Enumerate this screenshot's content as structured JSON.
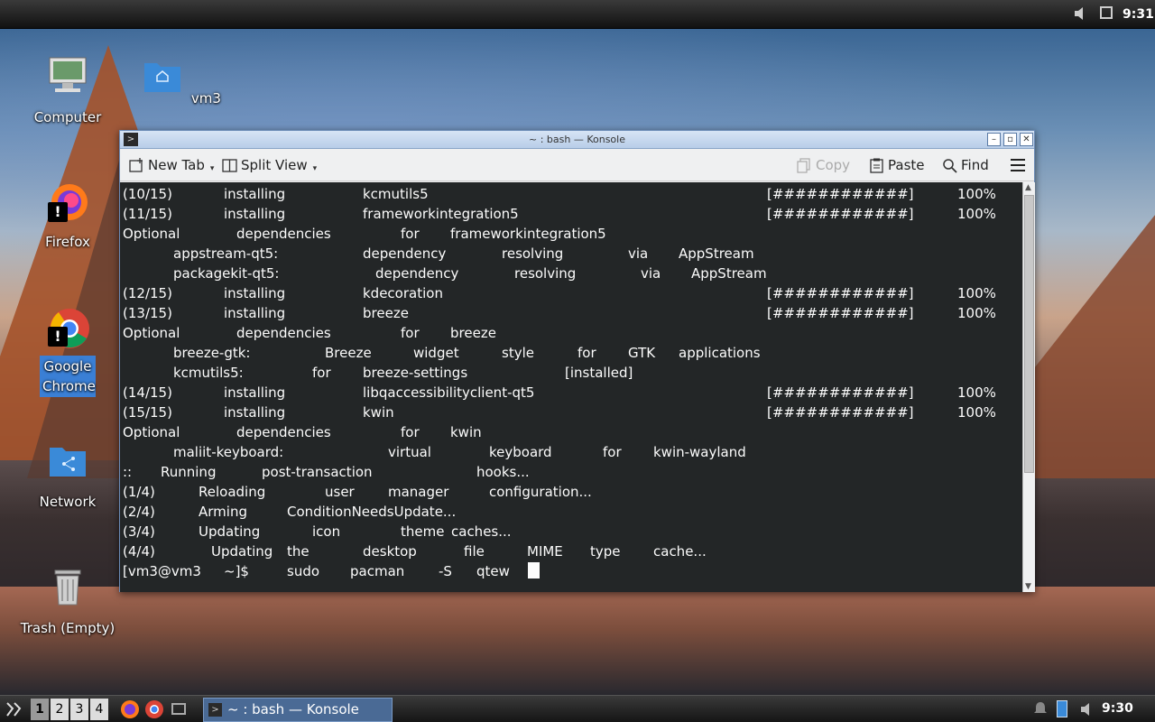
{
  "top_panel": {
    "clock": "9:31",
    "icons": [
      "speaker-icon",
      "screen-icon"
    ]
  },
  "desktop_icons": [
    {
      "label": "Computer",
      "icon": "computer-icon"
    },
    {
      "label": "vm3",
      "icon": "home-folder-icon"
    },
    {
      "label": "Firefox",
      "icon": "firefox-icon"
    },
    {
      "label": "Google Chrome",
      "icon": "chrome-icon"
    },
    {
      "label": "Network",
      "icon": "network-folder-icon"
    },
    {
      "label": "Trash (Empty)",
      "icon": "trash-icon"
    }
  ],
  "window": {
    "title": "~ : bash — Konsole",
    "toolbar": {
      "new_tab": "New Tab",
      "split_view": "Split View",
      "copy": "Copy",
      "paste": "Paste",
      "find": "Find"
    }
  },
  "terminal_lines": [
    [
      "(10/15)",
      "installing",
      "kcmutils5",
      "[############]",
      "100%"
    ],
    [
      "(11/15)",
      "installing",
      "frameworkintegration5",
      "[############]",
      "100%"
    ],
    [
      "Optional",
      "dependencies",
      "for",
      "frameworkintegration5"
    ],
    [
      "appstream-qt5:",
      "dependency",
      "resolving",
      "via",
      "AppStream"
    ],
    [
      "packagekit-qt5:",
      "dependency",
      "resolving",
      "via",
      "AppStream"
    ],
    [
      "(12/15)",
      "installing",
      "kdecoration",
      "[############]",
      "100%"
    ],
    [
      "(13/15)",
      "installing",
      "breeze",
      "[############]",
      "100%"
    ],
    [
      "Optional",
      "dependencies",
      "for",
      "breeze"
    ],
    [
      "breeze-gtk:",
      "Breeze",
      "widget",
      "style",
      "for",
      "GTK",
      "applications"
    ],
    [
      "kcmutils5:",
      "for",
      "breeze-settings",
      "[installed]"
    ],
    [
      "(14/15)",
      "installing",
      "libqaccessibilityclient-qt5",
      "[############]",
      "100%"
    ],
    [
      "(15/15)",
      "installing",
      "kwin",
      "[############]",
      "100%"
    ],
    [
      "Optional",
      "dependencies",
      "for",
      "kwin"
    ],
    [
      "maliit-keyboard:",
      "virtual",
      "keyboard",
      "for",
      "kwin-wayland"
    ],
    [
      "::",
      "Running",
      "post-transaction",
      "hooks..."
    ],
    [
      "(1/4)",
      "Reloading",
      "user",
      "manager",
      "configuration..."
    ],
    [
      "(2/4)",
      "Arming",
      "ConditionNeedsUpdate..."
    ],
    [
      "(3/4)",
      "Updating",
      "icon",
      "theme",
      "caches..."
    ],
    [
      "(4/4)",
      "Updating",
      "the",
      "desktop",
      "file",
      "MIME",
      "type",
      "cache..."
    ],
    [
      "[vm3@vm3",
      "~]$",
      "sudo",
      "pacman",
      "-S",
      "qtew"
    ]
  ],
  "taskbar": {
    "desktops": [
      "1",
      "2",
      "3",
      "4"
    ],
    "task_label": "~ : bash — Konsole",
    "clock": "9:30"
  }
}
